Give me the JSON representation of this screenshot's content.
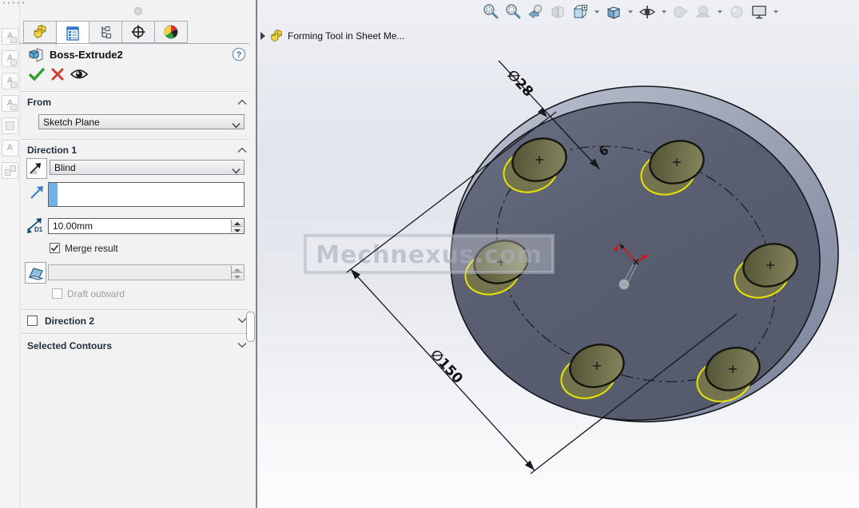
{
  "property_manager": {
    "feature_title": "Boss-Extrude2",
    "tabs": [
      "featuremanager-design-tree",
      "propertymanager",
      "configurationmanager",
      "dimxpertmanager",
      "displaymanager"
    ],
    "active_tab": "propertymanager",
    "groups": {
      "from": {
        "label": "From",
        "plane_value": "Sketch Plane"
      },
      "direction1": {
        "label": "Direction 1",
        "end_condition_value": "Blind",
        "depth_value": "10.00mm",
        "depth_icon_label": "D1",
        "merge_result_label": "Merge result",
        "merge_result_checked": true,
        "draft_outward_label": "Draft outward",
        "draft_outward_checked": false
      },
      "direction2": {
        "label": "Direction 2",
        "checked": false
      },
      "selected_contours": {
        "label": "Selected Contours"
      }
    },
    "left_strip_glyph": "A"
  },
  "viewport": {
    "flyout_label": "Forming Tool in Sheet Me...",
    "watermark_text": "Mechnexus.com",
    "dimensions": {
      "hole_diameter": "∅28",
      "bolt_circle_diameter": "∅150",
      "hole_count": "6"
    }
  },
  "hud_toolbar": {
    "icons": [
      "zoom-to-fit",
      "zoom-to-area",
      "previous-view",
      "section-view",
      "view-orientation",
      "display-style",
      "hide-show-items",
      "edit-appearance",
      "apply-scene",
      "view-settings",
      "camera-views"
    ]
  },
  "colors": {
    "highlight_yellow": "#e8e400",
    "part_face": "#575d6f",
    "part_side": "#9aa2b4",
    "selection_blue": "#6fb2e8",
    "confirm_green": "#2e9e30",
    "cancel_red": "#d03c30",
    "accent_blue": "#2d6bb0"
  }
}
